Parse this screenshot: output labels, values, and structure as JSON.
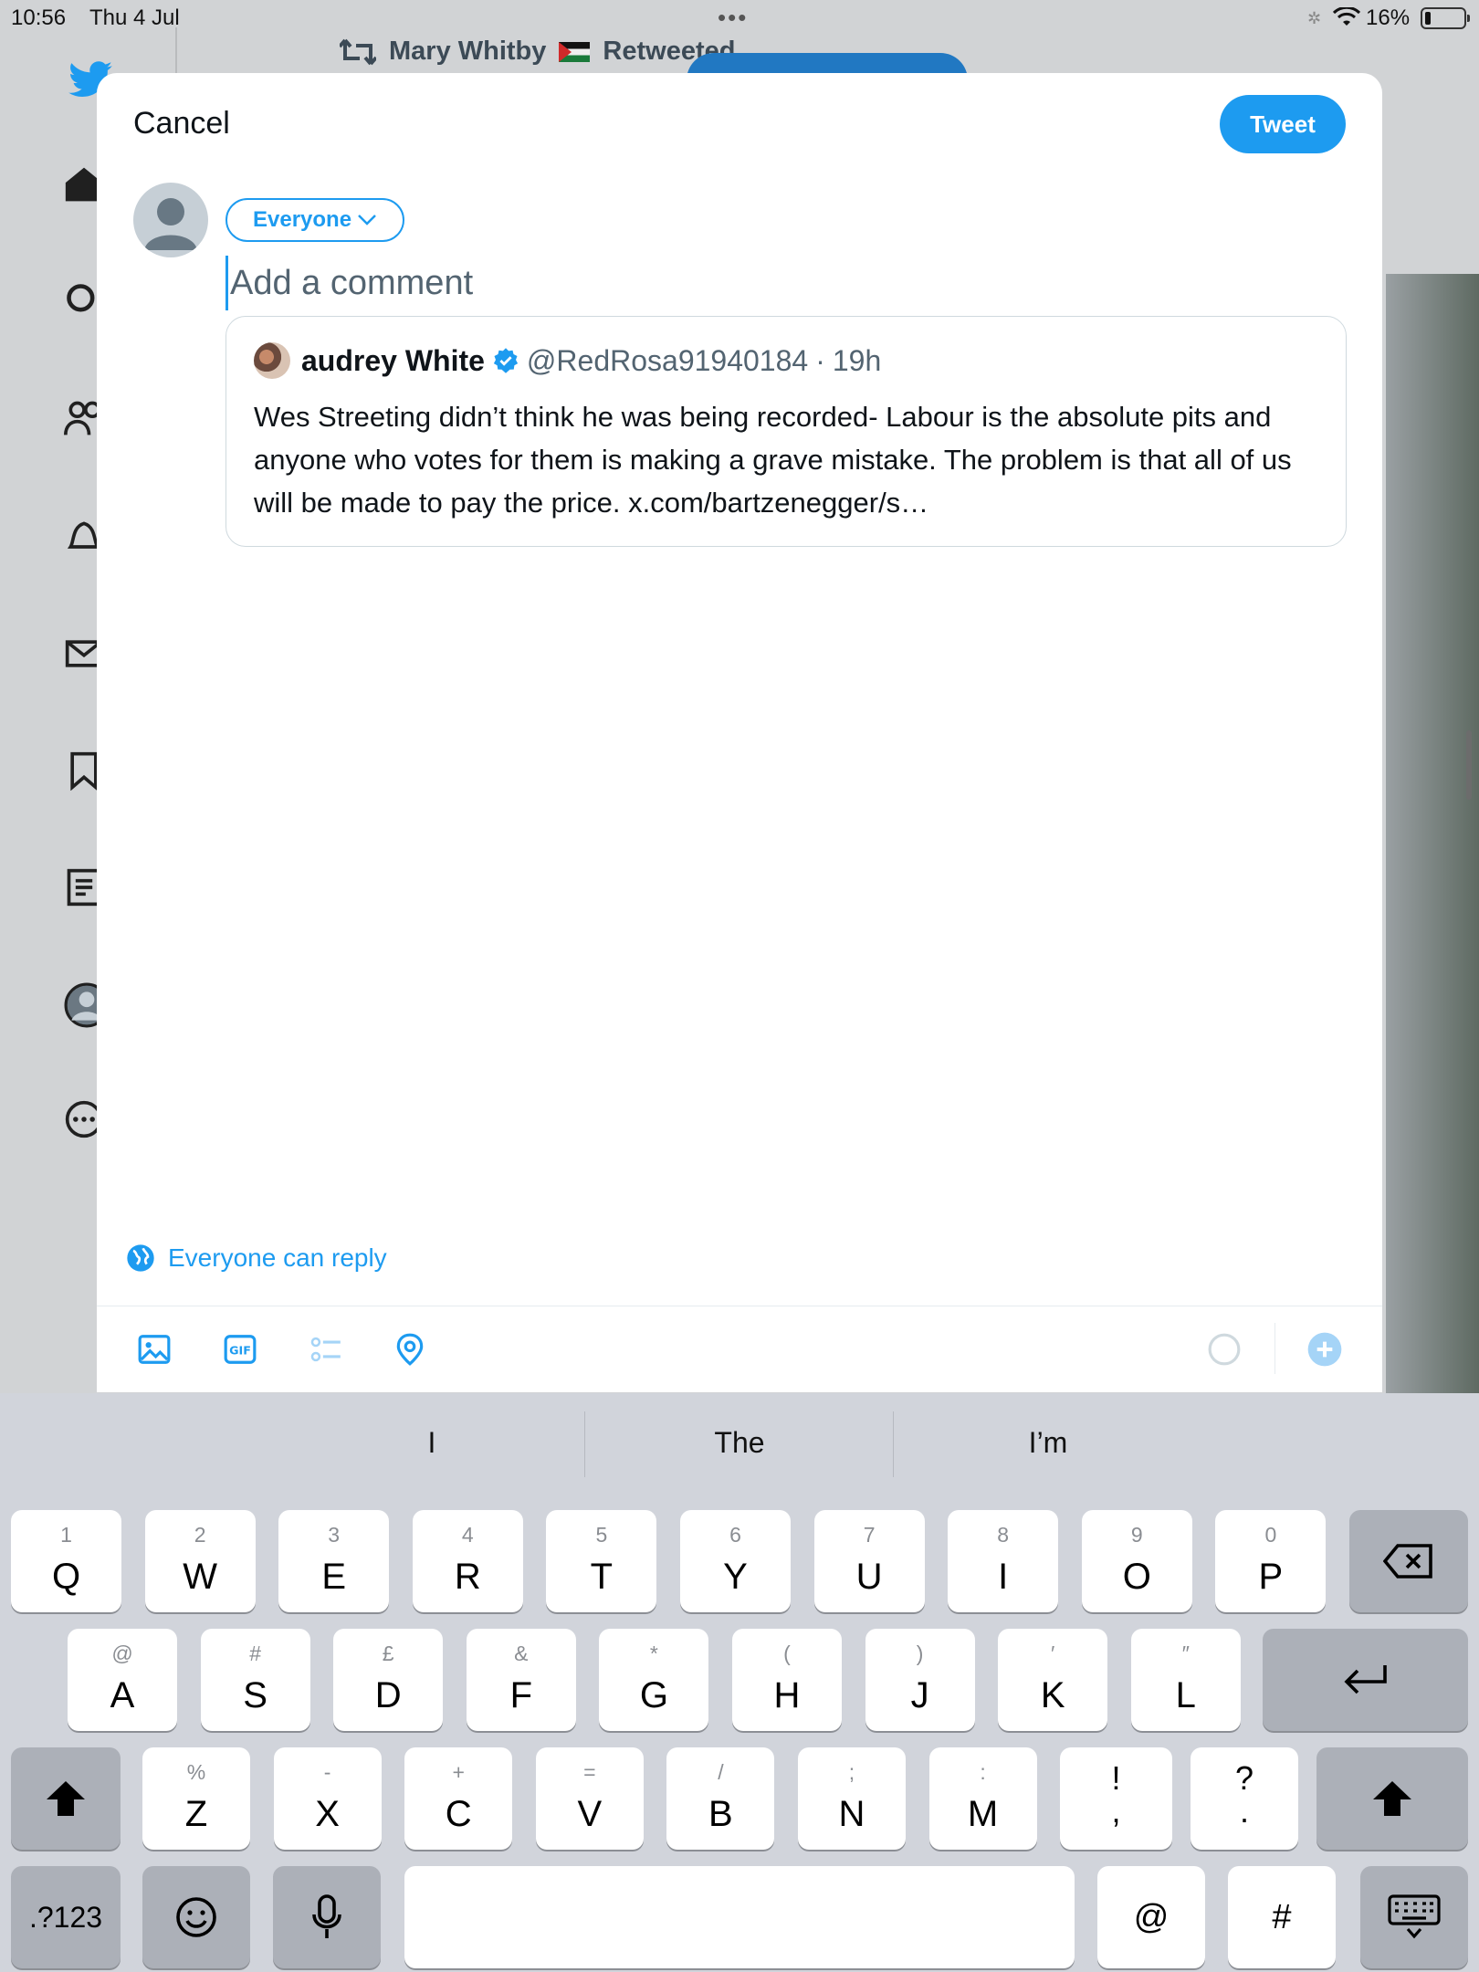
{
  "status_bar": {
    "time": "10:56",
    "date": "Thu 4 Jul",
    "battery": "16%"
  },
  "background": {
    "retweet_label": "Mary Whitby",
    "retweet_suffix": "Retweeted"
  },
  "composer": {
    "cancel_label": "Cancel",
    "tweet_label": "Tweet",
    "audience_label": "Everyone",
    "comment_placeholder": "Add a comment",
    "reply_setting_label": "Everyone can reply"
  },
  "quoted_tweet": {
    "name": "audrey White",
    "handle": "@RedRosa91940184",
    "separator": "·",
    "age": "19h",
    "text": "Wes Streeting didn’t think he was being recorded- Labour is the absolute pits and anyone who votes for them is making a grave mistake. The problem is that all of us will be made to pay the price. x.com/bartzenegger/s…"
  },
  "keyboard": {
    "suggestions": [
      "I",
      "The",
      "I’m"
    ],
    "row1": [
      {
        "k": "Q",
        "a": "1"
      },
      {
        "k": "W",
        "a": "2"
      },
      {
        "k": "E",
        "a": "3"
      },
      {
        "k": "R",
        "a": "4"
      },
      {
        "k": "T",
        "a": "5"
      },
      {
        "k": "Y",
        "a": "6"
      },
      {
        "k": "U",
        "a": "7"
      },
      {
        "k": "I",
        "a": "8"
      },
      {
        "k": "O",
        "a": "9"
      },
      {
        "k": "P",
        "a": "0"
      }
    ],
    "row2": [
      {
        "k": "A",
        "a": "@"
      },
      {
        "k": "S",
        "a": "#"
      },
      {
        "k": "D",
        "a": "£"
      },
      {
        "k": "F",
        "a": "&"
      },
      {
        "k": "G",
        "a": "*"
      },
      {
        "k": "H",
        "a": "("
      },
      {
        "k": "J",
        "a": ")"
      },
      {
        "k": "K",
        "a": "′"
      },
      {
        "k": "L",
        "a": "″"
      }
    ],
    "row3": [
      {
        "k": "Z",
        "a": "%"
      },
      {
        "k": "X",
        "a": "-"
      },
      {
        "k": "C",
        "a": "+"
      },
      {
        "k": "V",
        "a": "="
      },
      {
        "k": "B",
        "a": "/"
      },
      {
        "k": "N",
        "a": ";"
      },
      {
        "k": "M",
        "a": ":"
      }
    ],
    "punct_1": {
      "top": "!",
      "bottom": ","
    },
    "punct_2": {
      "top": "?",
      "bottom": "."
    },
    "numbers_label": ".?123",
    "at_label": "@",
    "hash_label": "#"
  },
  "colors": {
    "accent": "#1d9bf0",
    "keyboard_bg": "#d1d4db"
  }
}
